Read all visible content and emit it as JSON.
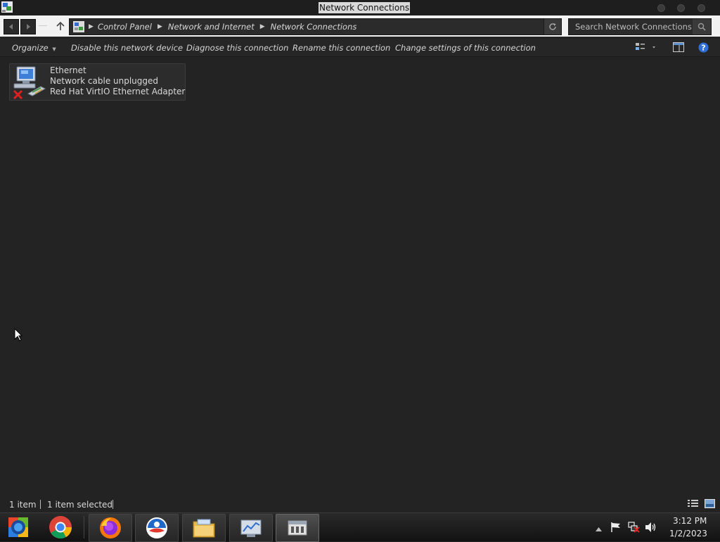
{
  "window": {
    "title": "Network Connections"
  },
  "navigation": {
    "breadcrumb": [
      "Control Panel",
      "Network and Internet",
      "Network Connections"
    ],
    "search_placeholder": "Search Network Connections"
  },
  "toolbar": {
    "organize_label": "Organize",
    "commands": [
      "Disable this network device",
      "Diagnose this connection",
      "Rename this connection",
      "Change settings of this connection"
    ]
  },
  "connection": {
    "name": "Ethernet",
    "status": "Network cable unplugged",
    "adapter": "Red Hat VirtIO Ethernet Adapter"
  },
  "statusbar": {
    "item_count": "1 item",
    "selected": "1 item selected"
  },
  "taskbar": {
    "apps": [
      "start-orb-icon",
      "chrome-icon",
      "firefox-icon",
      "edge-icon",
      "file-explorer-icon",
      "control-panel-icon",
      "network-window-icon"
    ],
    "time": "3:12 PM",
    "date": "1/2/2023"
  },
  "colors": {
    "background": "#232323",
    "titlebar": "#1e1e1e",
    "address_row": "#f2f2f2",
    "error_x": "#e0201f"
  }
}
